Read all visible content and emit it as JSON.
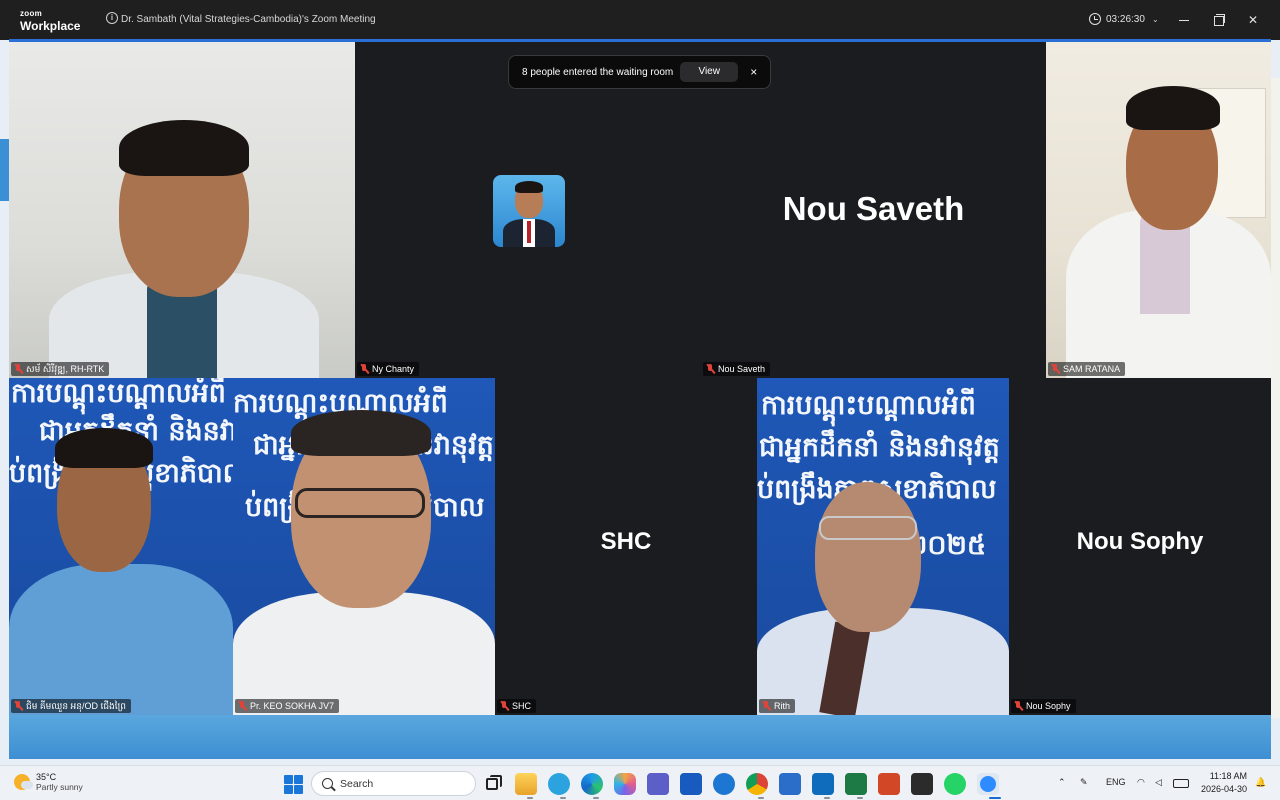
{
  "window": {
    "brand_small": "zoom",
    "brand_large": "Workplace",
    "title": "Dr. Sambath (Vital Strategies-Cambodia)'s Zoom Meeting",
    "timer": "03:26:30"
  },
  "notice": {
    "message": "8 people entered the waiting room",
    "view_label": "View",
    "close_label": "×"
  },
  "tiles": [
    {
      "name": "សម័ សិរីវុឌ្ឍ, RH-RTK"
    },
    {
      "name": "Ny Chanty"
    },
    {
      "name": "Nou Saveth",
      "big": "Nou Saveth"
    },
    {
      "name": "SAM RATANA"
    },
    {
      "name": "ជិម គីមឈួន អនុ/OD ជើងព្រៃ"
    },
    {
      "name": "Pr. KEO SOKHA JV7"
    },
    {
      "name": "SHC",
      "big": "SHC"
    },
    {
      "name": "Rith"
    },
    {
      "name": "Nou Sophy",
      "big": "Nou Sophy"
    }
  ],
  "banner_lines": [
    "ការបណ្តុះបណ្តាលអំពី",
    "ជាអ្នកដឹកនាំ និងនវានុវត្ត",
    "ប់ពង្រឹងភាពសុខាភិបាល",
    "២០២៥"
  ],
  "taskbar": {
    "weather_temp": "35°C",
    "weather_desc": "Partly sunny",
    "search_placeholder": "Search",
    "lang": "ENG",
    "time": "11:18 AM",
    "date": "2026-04-30",
    "apps": [
      "task-view",
      "file-explorer",
      "telegram",
      "edge",
      "copilot",
      "teams",
      "word",
      "outlook-web",
      "chrome",
      "store",
      "outlook",
      "excel",
      "powerpoint",
      "calculator",
      "whatsapp",
      "zoom"
    ]
  },
  "colors": {
    "accent": "#2a6fd6",
    "stage": "#1b1c1f",
    "mic_muted": "#e0433a",
    "banner_blue": "#1f58b8"
  }
}
